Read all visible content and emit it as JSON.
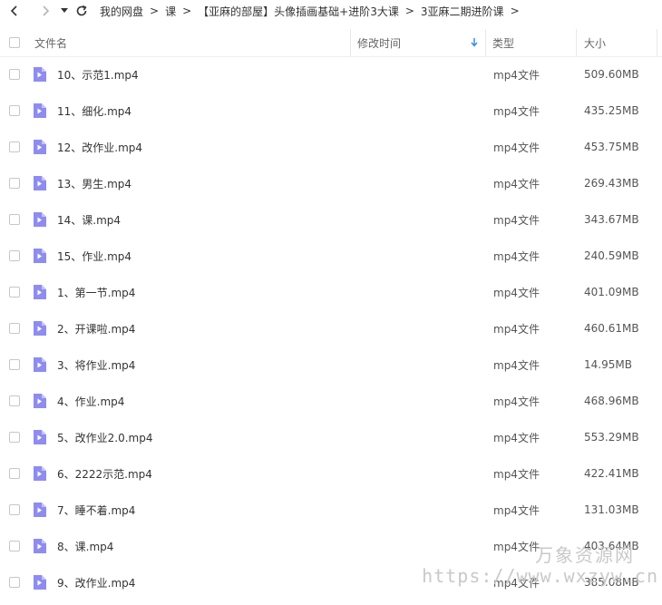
{
  "breadcrumb": {
    "items": [
      "我的网盘",
      "课",
      "【亚麻的部屋】头像插画基础+进阶3大课",
      "3亚麻二期进阶课"
    ],
    "separator": ">"
  },
  "columns": {
    "name": "文件名",
    "modified": "修改时间",
    "type": "类型",
    "size": "大小"
  },
  "files": [
    {
      "name": "10、示范1.mp4",
      "type": "mp4文件",
      "size": "509.60MB"
    },
    {
      "name": "11、细化.mp4",
      "type": "mp4文件",
      "size": "435.25MB"
    },
    {
      "name": "12、改作业.mp4",
      "type": "mp4文件",
      "size": "453.75MB"
    },
    {
      "name": "13、男生.mp4",
      "type": "mp4文件",
      "size": "269.43MB"
    },
    {
      "name": "14、课.mp4",
      "type": "mp4文件",
      "size": "343.67MB"
    },
    {
      "name": "15、作业.mp4",
      "type": "mp4文件",
      "size": "240.59MB"
    },
    {
      "name": "1、第一节.mp4",
      "type": "mp4文件",
      "size": "401.09MB"
    },
    {
      "name": "2、开课啦.mp4",
      "type": "mp4文件",
      "size": "460.61MB"
    },
    {
      "name": "3、将作业.mp4",
      "type": "mp4文件",
      "size": "14.95MB"
    },
    {
      "name": "4、作业.mp4",
      "type": "mp4文件",
      "size": "468.96MB"
    },
    {
      "name": "5、改作业2.0.mp4",
      "type": "mp4文件",
      "size": "553.29MB"
    },
    {
      "name": "6、2222示范.mp4",
      "type": "mp4文件",
      "size": "422.41MB"
    },
    {
      "name": "7、睡不着.mp4",
      "type": "mp4文件",
      "size": "131.03MB"
    },
    {
      "name": "8、课.mp4",
      "type": "mp4文件",
      "size": "403.64MB"
    },
    {
      "name": "9、改作业.mp4",
      "type": "mp4文件",
      "size": "385.08MB"
    }
  ],
  "watermark": {
    "text": "万象资源网",
    "url": "https://www.wxzyw.cn"
  },
  "colors": {
    "video_icon": "#8f8cf0",
    "sort_arrow": "#3a8ee6"
  }
}
